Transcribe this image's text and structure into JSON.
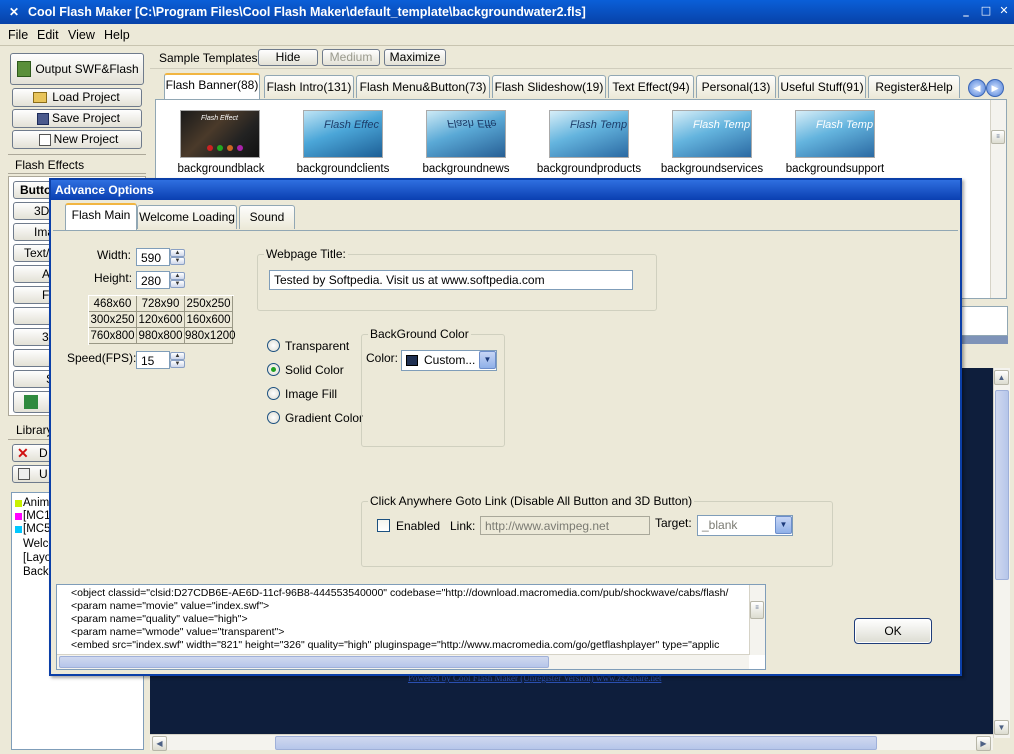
{
  "window": {
    "title": "Cool Flash Maker [C:\\Program Files\\Cool Flash Maker\\default_template\\backgroundwater2.fls]",
    "app_icon": "app-icon",
    "min_label": "_",
    "max_label": "□",
    "close_label": "✕"
  },
  "menu": [
    "File",
    "Edit",
    "View",
    "Help"
  ],
  "left_panel": {
    "output_button": "Output SWF&Flash",
    "load_button": "Load Project",
    "save_button": "Save Project",
    "new_button": "New Project",
    "flash_effects_label": "Flash Effects",
    "effect_buttons": [
      "Butto",
      "3D",
      "Ima",
      "Text/",
      "A",
      "Fl",
      "",
      "3D",
      "",
      "S"
    ],
    "library_label": "Library",
    "library_delete": "D",
    "library_update": "U",
    "library_items": [
      "Anima",
      "[MC1]",
      "[MC5]",
      "Welco",
      "[Layo",
      "Back"
    ],
    "library_colors": [
      "#c8f000",
      "#ff00ff",
      "#00c8ff"
    ]
  },
  "top_bar": {
    "sample_templates_label": "Sample Templates",
    "hide_button": "Hide",
    "medium_button": "Medium",
    "maximize_button": "Maximize"
  },
  "template_tabs": [
    "Flash Banner(88)",
    "Flash Intro(131)",
    "Flash Menu&Button(73)",
    "Flash Slideshow(19)",
    "Text Effect(94)",
    "Personal(13)",
    "Useful Stuff(91)",
    "Register&Help"
  ],
  "templates": [
    {
      "name": "backgroundblack",
      "thumb_text": "Flash Effect"
    },
    {
      "name": "backgroundclients",
      "thumb_text": "Flash Effec"
    },
    {
      "name": "backgroundnews",
      "thumb_text": "Flash Effe"
    },
    {
      "name": "backgroundproducts",
      "thumb_text": "Flash Temp"
    },
    {
      "name": "backgroundservices",
      "thumb_text": "Flash Temp"
    },
    {
      "name": "backgroundsupport",
      "thumb_text": "Flash Temp"
    }
  ],
  "preview": {
    "footer_link": "Powered by Cool Flash Maker (Unregister Version) www.zs2share.net"
  },
  "dialog": {
    "title": "Advance Options",
    "tabs": [
      "Flash Main",
      "Welcome Loading",
      "Sound"
    ],
    "width_label": "Width:",
    "width_value": "590",
    "height_label": "Height:",
    "height_value": "280",
    "sizes": [
      "468x60",
      "728x90",
      "250x250",
      "300x250",
      "120x600",
      "160x600",
      "760x800",
      "980x800",
      "980x1200"
    ],
    "fps_label": "Speed(FPS):",
    "fps_value": "15",
    "webpage_title_label": "Webpage Title:",
    "webpage_title_value": "Tested by Softpedia. Visit us at www.softpedia.com",
    "background_options": [
      "Transparent",
      "Solid Color",
      "Image Fill",
      "Gradient Color"
    ],
    "selected_background": "Solid Color",
    "bg_color_group": "BackGround Color",
    "color_label": "Color:",
    "color_value": "Custom...",
    "color_swatch": "#1f3052",
    "click_group": "Click Anywhere Goto Link (Disable All Button and 3D Button)",
    "enabled_label": "Enabled",
    "link_label": "Link:",
    "link_value": "http://www.avimpeg.net",
    "target_label": "Target:",
    "target_value": "_blank",
    "code_lines": [
      "<object classid=\"clsid:D27CDB6E-AE6D-11cf-96B8-444553540000\" codebase=\"http://download.macromedia.com/pub/shockwave/cabs/flash/",
      "  <param name=\"movie\" value=\"index.swf\">",
      "  <param name=\"quality\" value=\"high\">",
      "  <param name=\"wmode\" value=\"transparent\">",
      "  <embed src=\"index.swf\" width=\"821\" height=\"326\" quality=\"high\" pluginspage=\"http://www.macromedia.com/go/getflashplayer\" type=\"applic"
    ],
    "ok_button": "OK"
  },
  "colors": {
    "titlebar": "#0a5fd8",
    "preview_bg": "#0e1e3c",
    "dialog_border": "#0b3fa8"
  }
}
